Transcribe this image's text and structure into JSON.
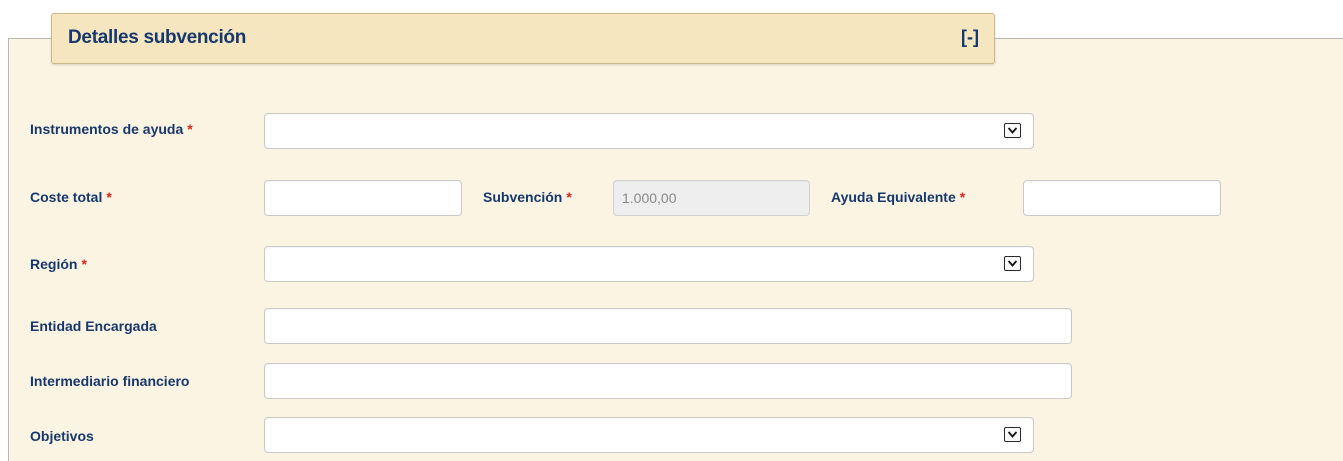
{
  "section": {
    "title": "Detalles subvención",
    "collapse_label": "[-]"
  },
  "form": {
    "required_mark": "*",
    "instrumentos": {
      "label": "Instrumentos de ayuda",
      "value": "",
      "icon": "chevron-down-icon"
    },
    "coste_total": {
      "label": "Coste total",
      "value": ""
    },
    "subvencion": {
      "label": "Subvención",
      "value": "1.000,00",
      "disabled": true
    },
    "ayuda_equivalente": {
      "label": "Ayuda Equivalente",
      "value": ""
    },
    "region": {
      "label": "Región",
      "value": "",
      "icon": "chevron-down-icon"
    },
    "entidad_encargada": {
      "label": "Entidad Encargada",
      "value": ""
    },
    "intermediario": {
      "label": "Intermediario financiero",
      "value": ""
    },
    "objetivos": {
      "label": "Objetivos",
      "value": "",
      "icon": "chevron-down-icon"
    }
  },
  "colors": {
    "label": "#17386d",
    "required": "#d9261c",
    "panel_bg": "#fcf4e3",
    "header_bg": "#f6e6bf"
  }
}
